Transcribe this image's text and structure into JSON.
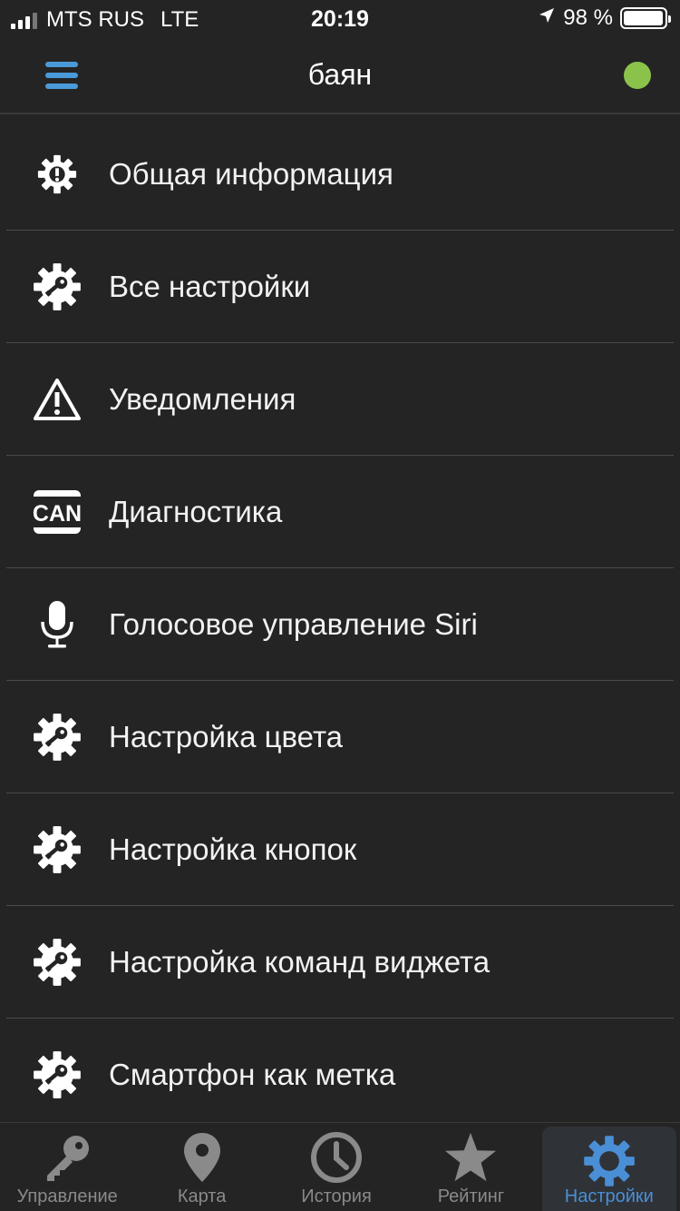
{
  "status_bar": {
    "carrier": "MTS RUS",
    "network": "LTE",
    "time": "20:19",
    "battery": "98 %",
    "battery_level": 0.98
  },
  "nav": {
    "title": "баян",
    "status_color": "#8bc34a",
    "menu_icon": "hamburger-icon"
  },
  "menu": {
    "items": [
      {
        "label": "Общая информация",
        "icon": "gear-info-icon"
      },
      {
        "label": "Все настройки",
        "icon": "gear-key-icon"
      },
      {
        "label": "Уведомления",
        "icon": "warning-triangle-icon"
      },
      {
        "label": "Диагностика",
        "icon": "can-icon",
        "icon_text": "CAN"
      },
      {
        "label": "Голосовое управление Siri",
        "icon": "microphone-icon"
      },
      {
        "label": "Настройка цвета",
        "icon": "gear-key-icon"
      },
      {
        "label": "Настройка кнопок",
        "icon": "gear-key-icon"
      },
      {
        "label": "Настройка команд виджета",
        "icon": "gear-key-icon"
      },
      {
        "label": "Смартфон как метка",
        "icon": "gear-key-icon"
      }
    ]
  },
  "tabs": [
    {
      "label": "Управление",
      "icon": "key-icon",
      "active": false
    },
    {
      "label": "Карта",
      "icon": "map-pin-icon",
      "active": false
    },
    {
      "label": "История",
      "icon": "clock-icon",
      "active": false
    },
    {
      "label": "Рейтинг",
      "icon": "star-icon",
      "active": false
    },
    {
      "label": "Настройки",
      "icon": "gear-icon",
      "active": true
    }
  ],
  "colors": {
    "background": "#242424",
    "accent": "#4a8fd6",
    "inactive": "#8a8a8a"
  }
}
